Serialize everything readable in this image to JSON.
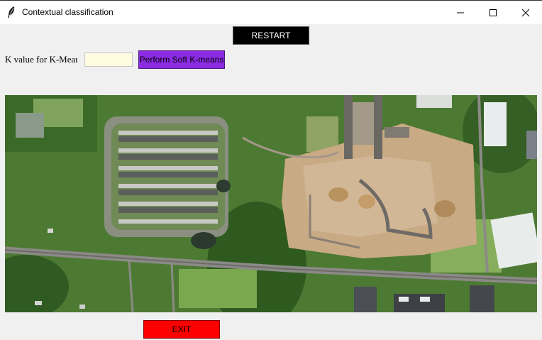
{
  "window": {
    "title": "Contextual classification",
    "controls": {
      "minimize": "minimize-icon",
      "maximize": "maximize-icon",
      "close": "close-icon"
    }
  },
  "toolbar": {
    "restart_label": "RESTART",
    "k_label": "K value for K-Mear",
    "k_value": "",
    "soft_kmeans_label": "Perform Soft K-means"
  },
  "footer": {
    "exit_label": "EXIT"
  },
  "colors": {
    "restart_bg": "#000000",
    "soft_kmeans_bg": "#8b2be2",
    "exit_bg": "#ff0000",
    "input_bg": "#fffbe0"
  },
  "image": {
    "subject": "aerial photograph"
  }
}
